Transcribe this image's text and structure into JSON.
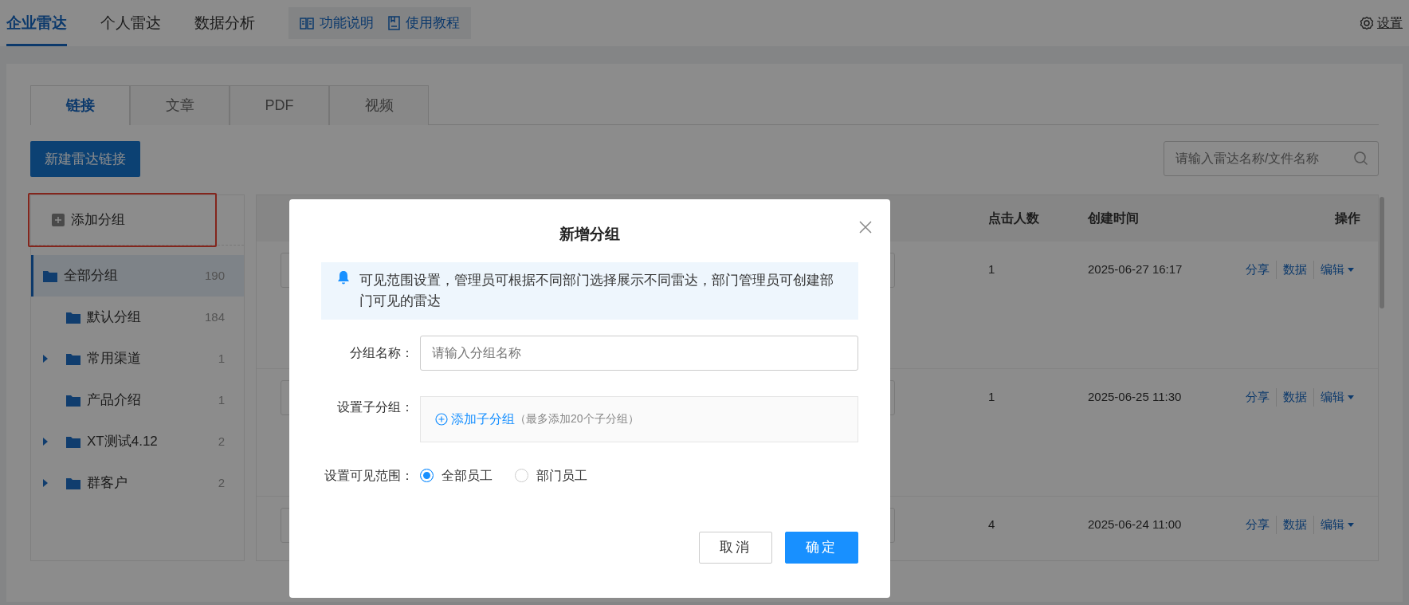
{
  "top_nav": {
    "tabs": [
      {
        "label": "企业雷达",
        "selected": true
      },
      {
        "label": "个人雷达",
        "selected": false
      },
      {
        "label": "数据分析",
        "selected": false
      }
    ],
    "help_links": [
      {
        "label": "功能说明",
        "kind": "book"
      },
      {
        "label": "使用教程",
        "kind": "doc"
      }
    ],
    "settings": "设置"
  },
  "content_tabs": [
    {
      "label": "链接",
      "selected": true
    },
    {
      "label": "文章",
      "selected": false
    },
    {
      "label": "PDF",
      "selected": false
    },
    {
      "label": "视频",
      "selected": false
    }
  ],
  "new_button": "新建雷达链接",
  "search": {
    "placeholder": "请输入雷达名称/文件名称"
  },
  "group_panel": {
    "add_label": "添加分组",
    "highlighted": true,
    "groups": [
      {
        "name": "全部分组",
        "count": "190",
        "selected": true,
        "children": [
          {
            "name": "默认分组",
            "count": "184",
            "selected": false
          },
          {
            "name": "常用渠道",
            "count": "1",
            "selected": false,
            "expanded": false
          },
          {
            "name": "产品介绍",
            "count": "1",
            "selected": false
          },
          {
            "name": "XT测试4.12",
            "count": "2",
            "selected": false,
            "expanded": false
          },
          {
            "name": "群客户",
            "count": "2",
            "selected": false,
            "expanded": false
          }
        ]
      }
    ]
  },
  "table": {
    "columns": [
      "点击人数",
      "创建时间",
      "操作"
    ],
    "rows": [
      {
        "clicks": "1",
        "created": "2025-06-27 16:17",
        "actions": [
          "分享",
          "数据",
          "编辑"
        ]
      },
      {
        "clicks": "1",
        "created": "2025-06-25 11:30",
        "actions": [
          "分享",
          "数据",
          "编辑"
        ]
      },
      {
        "clicks": "4",
        "created": "2025-06-24 11:00",
        "actions": [
          "分享",
          "数据",
          "编辑"
        ]
      }
    ]
  },
  "dialog": {
    "title": "新增分组",
    "notice": "可见范围设置，管理员可根据不同部门选择展示不同雷达，部门管理员可创建部门可见的雷达",
    "name_field": {
      "label": "分组名称：",
      "placeholder": "请输入分组名称"
    },
    "sub_groups": {
      "label": "设置子分组：",
      "add_link": "添加子分组",
      "hint": "（最多添加20个子分组）"
    },
    "visibility": {
      "label": "设置可见范围：",
      "options": [
        {
          "label": "全部员工",
          "selected": true
        },
        {
          "label": "部门员工",
          "selected": false
        }
      ]
    },
    "buttons": [
      {
        "label": "取消",
        "kind": "secondary"
      },
      {
        "label": "确定",
        "kind": "primary"
      }
    ]
  }
}
